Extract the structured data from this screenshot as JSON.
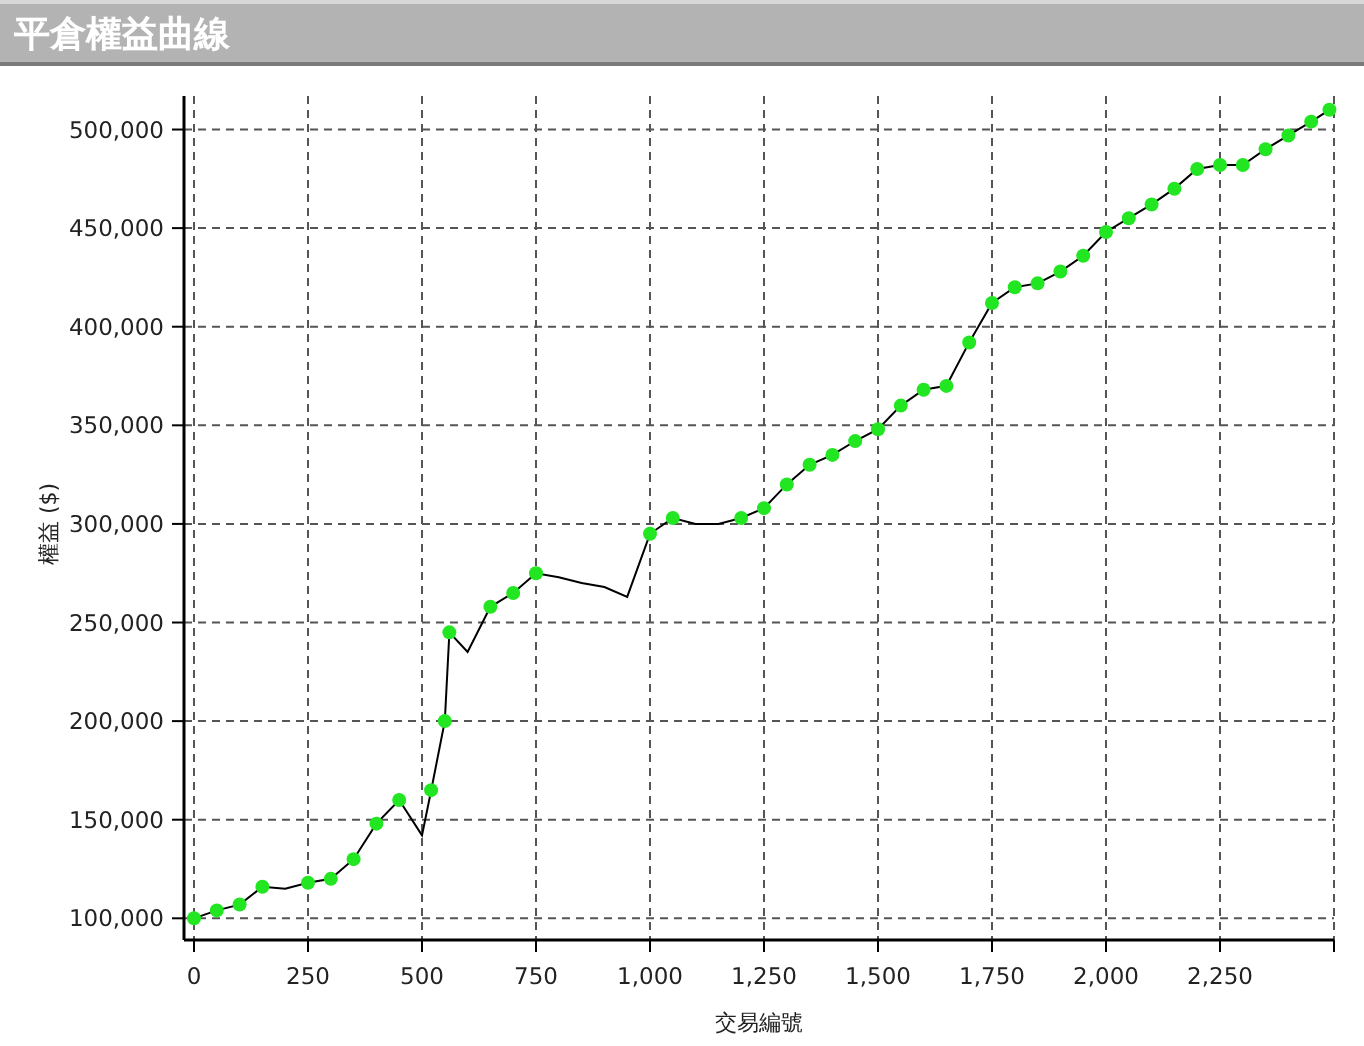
{
  "title": "平倉權益曲線",
  "chart_data": {
    "type": "line",
    "xlabel": "交易編號",
    "ylabel": "權益 ($)",
    "x": [
      0,
      50,
      100,
      150,
      200,
      250,
      300,
      350,
      400,
      450,
      500,
      520,
      550,
      560,
      600,
      650,
      700,
      750,
      800,
      850,
      900,
      950,
      1000,
      1050,
      1100,
      1150,
      1200,
      1250,
      1300,
      1350,
      1400,
      1450,
      1500,
      1550,
      1600,
      1650,
      1700,
      1750,
      1800,
      1850,
      1900,
      1950,
      2000,
      2050,
      2100,
      2150,
      2200,
      2250,
      2300,
      2350,
      2400,
      2450,
      2490
    ],
    "grid": true,
    "series": [
      {
        "color": "#000000",
        "marker": true,
        "values": [
          100000,
          104000,
          107000,
          116000,
          115000,
          118000,
          120000,
          130000,
          148000,
          160000,
          142000,
          165000,
          200000,
          245000,
          235000,
          258000,
          265000,
          275000,
          273000,
          270000,
          268000,
          263000,
          295000,
          303000,
          300000,
          300000,
          303000,
          308000,
          320000,
          330000,
          335000,
          342000,
          348000,
          360000,
          368000,
          370000,
          392000,
          412000,
          420000,
          422000,
          428000,
          436000,
          448000,
          455000,
          462000,
          470000,
          480000,
          482000,
          482000,
          490000,
          497000,
          504000,
          510000
        ]
      }
    ],
    "xlim": [
      0,
      2500
    ],
    "ylim": [
      89000,
      517000
    ],
    "xticks": [
      {
        "value": 0,
        "label": "0"
      },
      {
        "value": 250,
        "label": "250"
      },
      {
        "value": 500,
        "label": "500"
      },
      {
        "value": 750,
        "label": "750"
      },
      {
        "value": 1000,
        "label": "1,000"
      },
      {
        "value": 1250,
        "label": "1,250"
      },
      {
        "value": 1500,
        "label": "1,500"
      },
      {
        "value": 1750,
        "label": "1,750"
      },
      {
        "value": 2000,
        "label": "2,000"
      },
      {
        "value": 2250,
        "label": "2,250"
      }
    ],
    "yticks": [
      {
        "value": 100000,
        "label": "100,000"
      },
      {
        "value": 150000,
        "label": "150,000"
      },
      {
        "value": 200000,
        "label": "200,000"
      },
      {
        "value": 250000,
        "label": "250,000"
      },
      {
        "value": 300000,
        "label": "300,000"
      },
      {
        "value": 350000,
        "label": "350,000"
      },
      {
        "value": 400000,
        "label": "400,000"
      },
      {
        "value": 450000,
        "label": "450,000"
      },
      {
        "value": 500000,
        "label": "500,000"
      }
    ]
  }
}
